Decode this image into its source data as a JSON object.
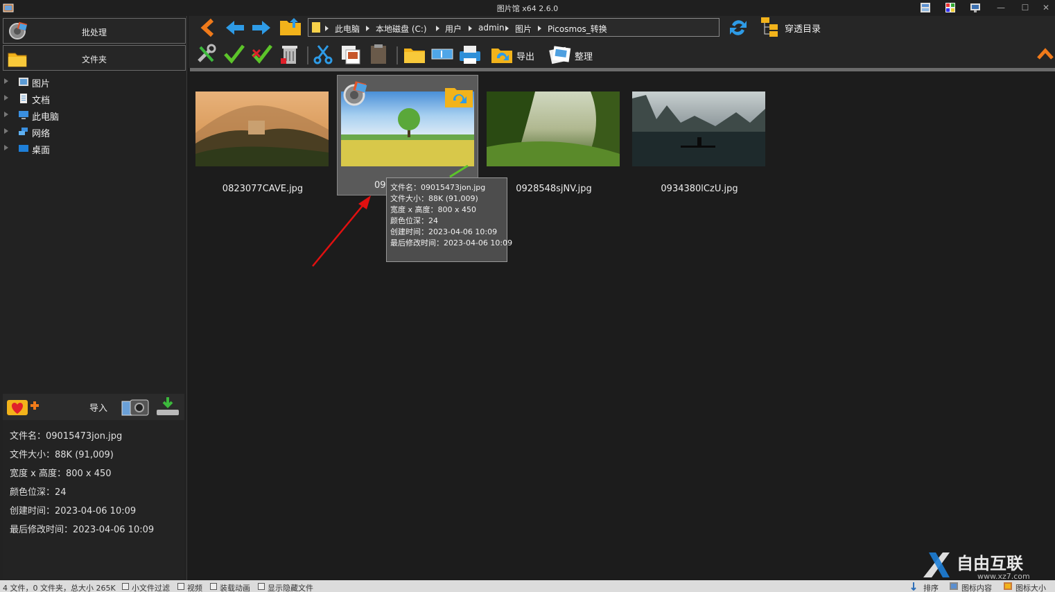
{
  "window": {
    "title": "图片馆 x64 2.6.0",
    "controls": [
      "—",
      "☐",
      "✕"
    ]
  },
  "left": {
    "batch_label": "批处理",
    "folder_label": "文件夹",
    "tree": [
      {
        "label": "图片",
        "icon": "pictures-icon"
      },
      {
        "label": "文档",
        "icon": "documents-icon"
      },
      {
        "label": "此电脑",
        "icon": "computer-icon"
      },
      {
        "label": "网络",
        "icon": "network-icon"
      },
      {
        "label": "桌面",
        "icon": "desktop-icon"
      }
    ],
    "import_label": "导入",
    "info": {
      "filename": "文件名：09015473jon.jpg",
      "filesize": "文件大小：88K (91,009)",
      "dimensions": "宽度 x 高度：800 x 450",
      "depth": "颜色位深：24",
      "created": "创建时间：2023-04-06 10:09",
      "modified": "最后修改时间：2023-04-06 10:09"
    }
  },
  "toolbar": {
    "breadcrumb": [
      "此电脑",
      "本地磁盘 (C:)",
      "用户",
      "admin",
      "图片",
      "Picosmos_转换"
    ],
    "through_dir_label": "穿透目录",
    "export_label": "导出",
    "organize_label": "整理"
  },
  "thumbnails": [
    {
      "name": "0823077CAVE.jpg",
      "selected": false
    },
    {
      "name": "09015473jon.jpg",
      "display_name": "090",
      "selected": true
    },
    {
      "name": "0928548sjNV.jpg",
      "selected": false
    },
    {
      "name": "0934380lCzU.jpg",
      "selected": false
    }
  ],
  "tooltip": {
    "lines": [
      "文件名：09015473jon.jpg",
      "文件大小：88K (91,009)",
      "宽度 x 高度：800 x 450",
      "颜色位深：24",
      "创建时间：2023-04-06 10:09",
      "最后修改时间：2023-04-06 10:09"
    ]
  },
  "status": {
    "summary": "4 文件，0 文件夹，总大小 265K",
    "small_file_filter": "小文件过滤",
    "video": "视频",
    "load_animation": "装载动画",
    "show_hidden": "显示隐藏文件",
    "sort": "排序",
    "icon_content": "图标内容",
    "icon_size": "图标大小"
  },
  "watermark": {
    "text": "自由互联",
    "url": "www.xz7.com"
  },
  "colors": {
    "accent_orange": "#f07a1a",
    "arrow_blue": "#2e9be6",
    "check_green": "#5cc42a",
    "annotation_red": "#e01010"
  }
}
